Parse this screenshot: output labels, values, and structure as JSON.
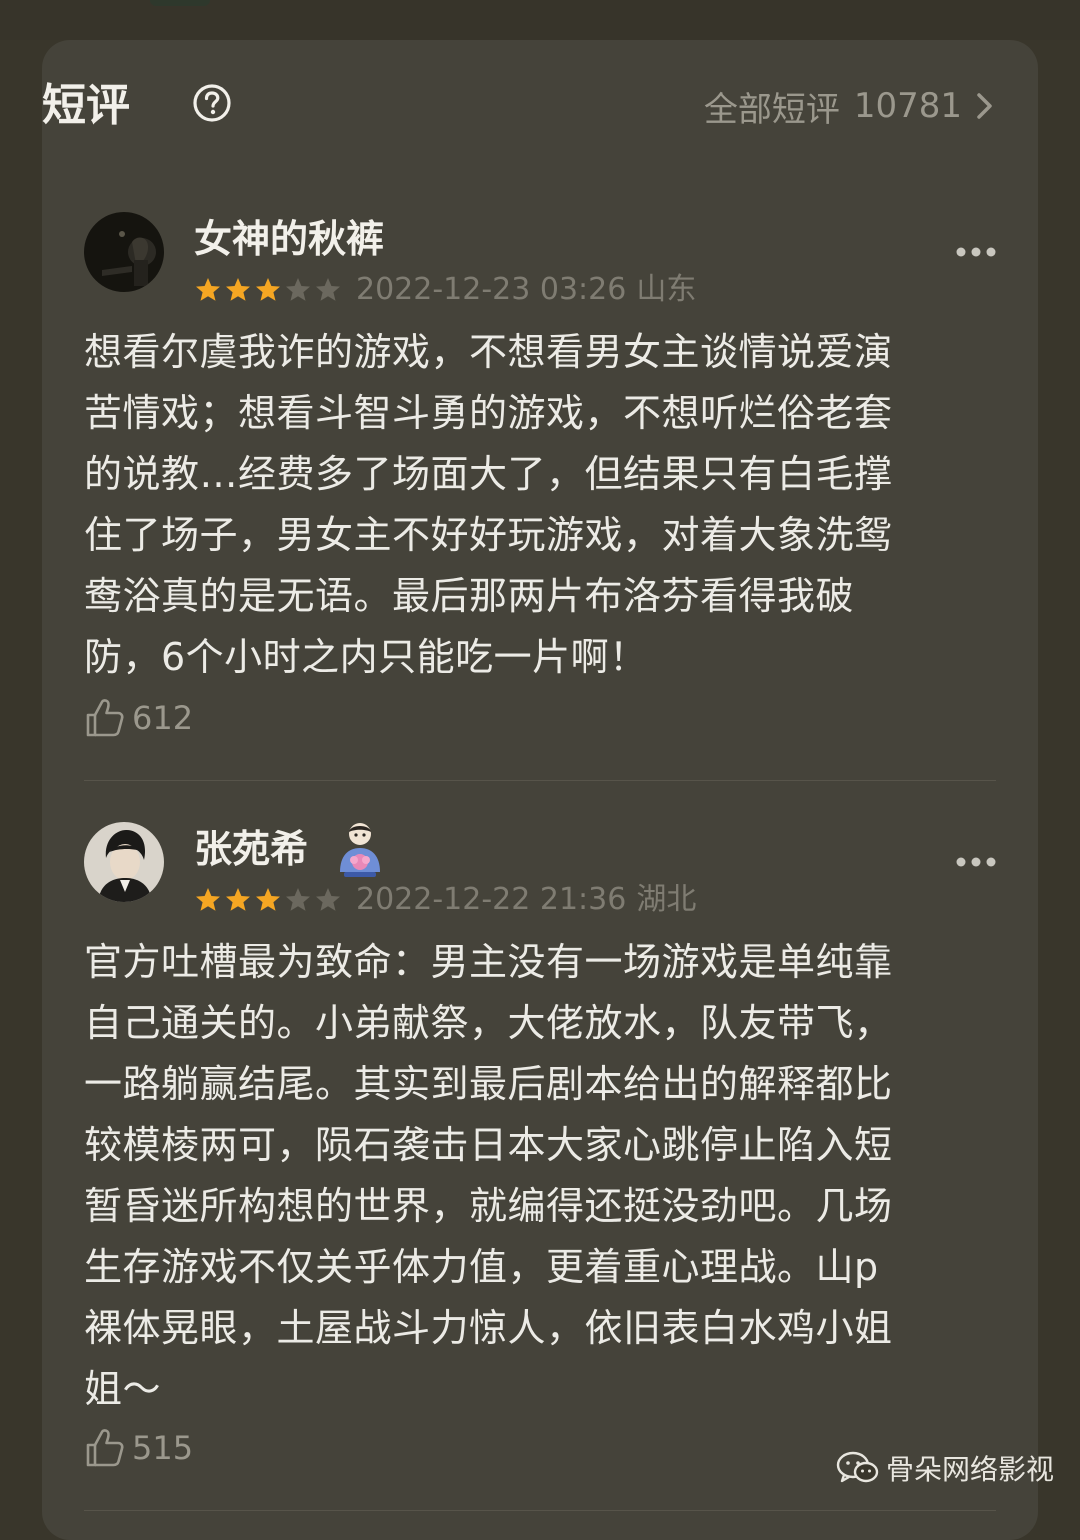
{
  "header": {
    "title": "短评",
    "all_label": "全部短评",
    "all_count": "10781"
  },
  "reviews": [
    {
      "username": "女神的秋裤",
      "rating_stars": 3,
      "rating_max": 5,
      "datetime": "2022-12-23 03:26",
      "location": "山东",
      "lines": [
        "想看尔虞我诈的游戏，不想看男女主谈情说爱演",
        "苦情戏；想看斗智斗勇的游戏，不想听烂俗老套",
        "的说教…经费多了场面大了，但结果只有白毛撑",
        "住了场子，男女主不好好玩游戏，对着大象洗鸳",
        "鸯浴真的是无语。最后那两片布洛芬看得我破",
        "防，6个小时之内只能吃一片啊！"
      ],
      "likes": "612"
    },
    {
      "username": "张苑希",
      "rating_stars": 3,
      "rating_max": 5,
      "datetime": "2022-12-22 21:36",
      "location": "湖北",
      "lines": [
        "官方吐槽最为致命：男主没有一场游戏是单纯靠",
        "自己通关的。小弟献祭，大佬放水，队友带飞，",
        "一路躺赢结尾。其实到最后剧本给出的解释都比",
        "较模棱两可，陨石袭击日本大家心跳停止陷入短",
        "暂昏迷所构想的世界，就编得还挺没劲吧。几场",
        "生存游戏不仅关乎体力值，更着重心理战。山p",
        "裸体晃眼，土屋战斗力惊人，依旧表白水鸡小姐",
        "姐～"
      ],
      "likes": "515"
    }
  ],
  "watermark": {
    "text": "骨朵网络影视"
  },
  "colors": {
    "card_bg": "#45433a",
    "page_bg": "#39362b",
    "star_filled": "#f5a623",
    "star_empty": "#6b685e",
    "text_primary": "#f2f0ea",
    "text_secondary": "#9b988d"
  },
  "icons": {
    "help": "question-circle-icon",
    "chevron": "chevron-right-icon",
    "more": "more-dots-icon",
    "like": "thumbs-up-icon",
    "badge": "member-badge-icon",
    "watermark": "wechat-icon"
  }
}
